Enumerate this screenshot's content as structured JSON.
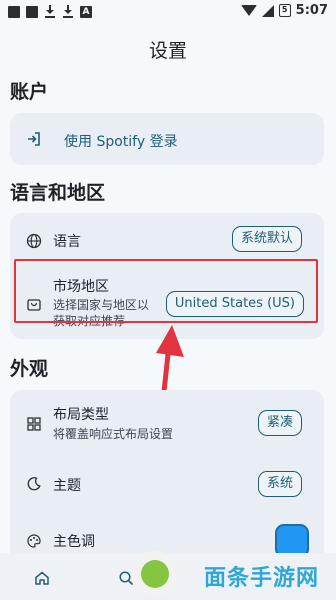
{
  "status_bar": {
    "time": "5:07",
    "battery": "5"
  },
  "page_title": "设置",
  "sections": {
    "account": {
      "heading": "账户",
      "login_label": "使用 Spotify 登录"
    },
    "language_region": {
      "heading": "语言和地区",
      "language_label": "语言",
      "language_value": "系统默认",
      "market_label": "市场地区",
      "market_desc_1": "选择国家与地区以",
      "market_desc_2": "获取对应推荐",
      "market_value": "United States (US)"
    },
    "appearance": {
      "heading": "外观",
      "layout_label": "布局类型",
      "layout_desc": "将覆盖响应式布局设置",
      "layout_value": "紧凑",
      "theme_label": "主题",
      "theme_value": "系统",
      "color_label": "主色调"
    }
  },
  "colors": {
    "accent": "#1e5f74",
    "swatch": "#2196f3",
    "highlight": "#e0343e",
    "arrow": "#e0343e"
  },
  "watermark_text": "面条手游网"
}
